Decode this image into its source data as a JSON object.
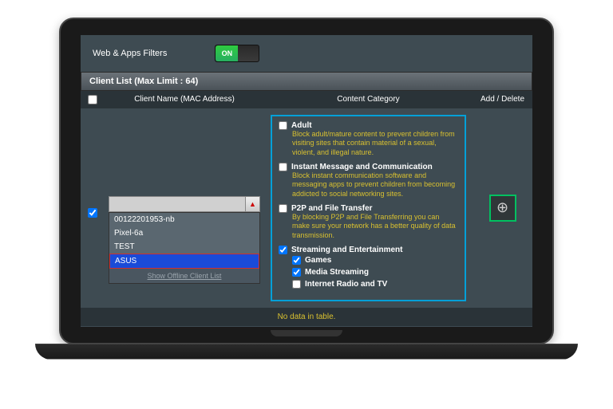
{
  "filter": {
    "label": "Web & Apps Filters",
    "toggle_state": "ON"
  },
  "section": {
    "title": "Client List (Max Limit : 64)"
  },
  "columns": {
    "client": "Client Name (MAC Address)",
    "category": "Content Category",
    "action": "Add / Delete"
  },
  "row": {
    "client_checked": true,
    "client_selected": "",
    "dropdown": {
      "items": [
        "00122201953-nb",
        "Pixel-6a",
        "TEST",
        "ASUS"
      ],
      "selected_index": 3,
      "offline_link": "Show Offline Client List"
    }
  },
  "categories": [
    {
      "key": "adult",
      "checked": false,
      "title": "Adult",
      "desc": "Block adult/mature content to prevent children from visiting sites that contain material of a sexual, violent, and illegal nature."
    },
    {
      "key": "im",
      "checked": false,
      "title": "Instant Message and Communication",
      "desc": "Block instant communication software and messaging apps to prevent children from becoming addicted to social networking sites."
    },
    {
      "key": "p2p",
      "checked": false,
      "title": "P2P and File Transfer",
      "desc": "By blocking P2P and File Transferring you can make sure your network has a better quality of data transmission."
    },
    {
      "key": "stream",
      "checked": true,
      "title": "Streaming and Entertainment",
      "desc": "",
      "subs": [
        {
          "checked": true,
          "label": "Games"
        },
        {
          "checked": true,
          "label": "Media Streaming"
        },
        {
          "checked": false,
          "label": "Internet Radio and TV"
        }
      ]
    }
  ],
  "footer": {
    "no_data": "No data in table."
  }
}
